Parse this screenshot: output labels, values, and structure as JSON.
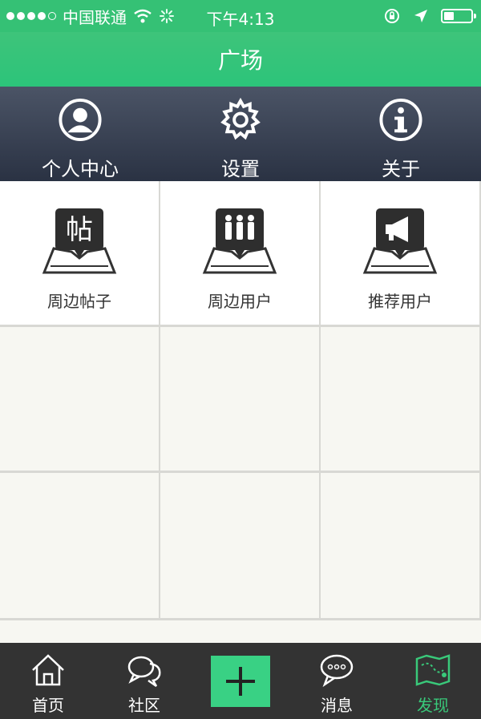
{
  "status_bar": {
    "carrier": "中国联通",
    "time": "下午4:13"
  },
  "nav": {
    "title": "广场"
  },
  "quick_actions": [
    {
      "label": "个人中心",
      "icon": "user-circle-icon"
    },
    {
      "label": "设置",
      "icon": "gear-icon"
    },
    {
      "label": "关于",
      "icon": "info-icon"
    }
  ],
  "grid_items": [
    {
      "label": "周边帖子",
      "icon": "map-post-icon",
      "glyph": "帖"
    },
    {
      "label": "周边用户",
      "icon": "map-users-icon"
    },
    {
      "label": "推荐用户",
      "icon": "map-megaphone-icon"
    }
  ],
  "tabs": [
    {
      "label": "首页",
      "icon": "home-icon"
    },
    {
      "label": "社区",
      "icon": "chat-bubbles-icon"
    },
    {
      "label": "",
      "icon": "plus-icon"
    },
    {
      "label": "消息",
      "icon": "message-icon"
    },
    {
      "label": "发现",
      "icon": "map-icon",
      "active": true
    }
  ],
  "colors": {
    "accent": "#39c97a",
    "header_dark": "#2a3243",
    "tabbar": "#333333"
  }
}
